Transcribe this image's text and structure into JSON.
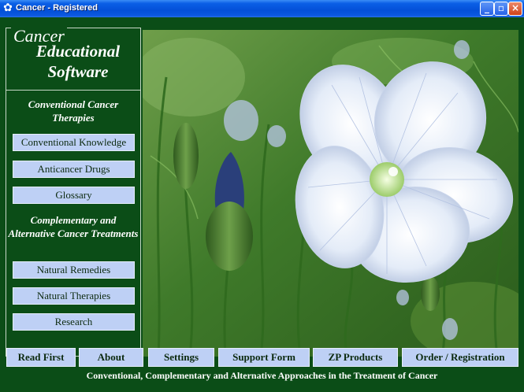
{
  "window": {
    "title": "Cancer - Registered",
    "controls": [
      "minimize",
      "maximize",
      "close"
    ]
  },
  "logo": {
    "word": "Cancer",
    "line1": "Educational",
    "line2": "Software"
  },
  "sidebar": {
    "conventional_title": "Conventional Cancer Therapies",
    "conventional_items": [
      "Conventional Knowledge",
      "Anticancer Drugs",
      "Glossary"
    ],
    "alternative_title": "Complementary and Alternative Cancer Treatments",
    "alternative_items": [
      "Natural Remedies",
      "Natural Therapies",
      "Research"
    ]
  },
  "bottom_nav": [
    "Read First",
    "About",
    "Settings",
    "Support Form",
    "ZP Products",
    "Order / Registration"
  ],
  "footer": "Conventional, Complementary and Alternative Approaches in the Treatment of Cancer",
  "colors": {
    "background": "#0b4d17",
    "button": "#bed0f5",
    "titlebar": "#0450d8"
  }
}
